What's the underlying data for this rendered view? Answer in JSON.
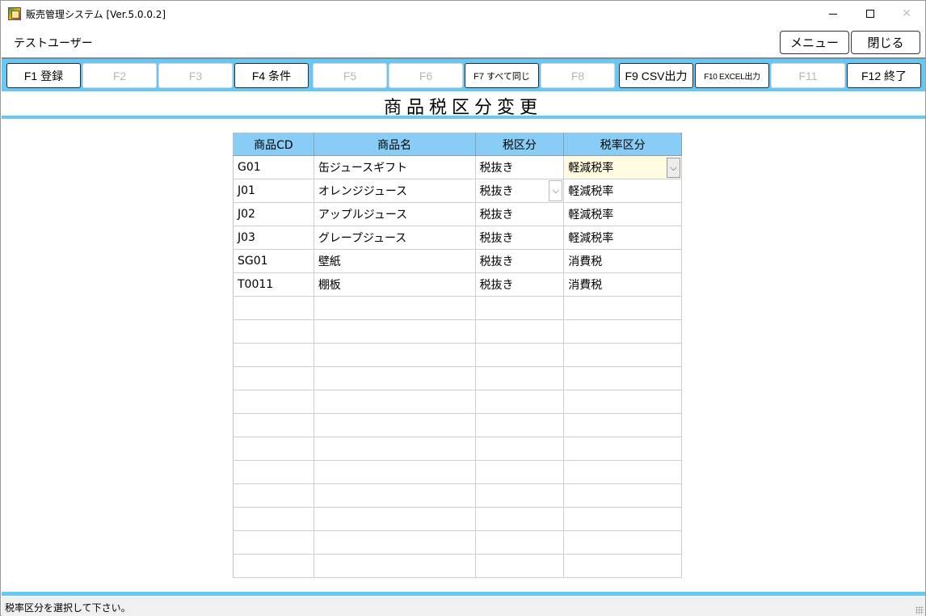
{
  "window": {
    "title": "販売管理システム [Ver.5.0.0.2]",
    "minimize_icon": "minimize-icon",
    "maximize_icon": "maximize-icon",
    "close_icon": "close-icon",
    "close_glyph": "✕"
  },
  "header": {
    "user": "テストユーザー",
    "menu_label": "メニュー",
    "close_label": "閉じる"
  },
  "fkeys": [
    {
      "label": "F1 登録",
      "enabled": true
    },
    {
      "label": "F2",
      "enabled": false
    },
    {
      "label": "F3",
      "enabled": false
    },
    {
      "label": "F4 条件",
      "enabled": true
    },
    {
      "label": "F5",
      "enabled": false
    },
    {
      "label": "F6",
      "enabled": false
    },
    {
      "label": "F7 すべて同じ",
      "enabled": true
    },
    {
      "label": "F8",
      "enabled": false
    },
    {
      "label": "F9 CSV出力",
      "enabled": true
    },
    {
      "label": "F10 EXCEL出力",
      "enabled": true
    },
    {
      "label": "F11",
      "enabled": false
    },
    {
      "label": "F12 終了",
      "enabled": true
    }
  ],
  "page": {
    "title": "商品税区分変更"
  },
  "grid": {
    "columns": [
      "商品CD",
      "商品名",
      "税区分",
      "税率区分"
    ],
    "rows": [
      [
        "G01",
        "缶ジュースギフト",
        "税抜き",
        "軽減税率"
      ],
      [
        "J01",
        "オレンジジュース",
        "税抜き",
        "軽減税率"
      ],
      [
        "J02",
        "アップルジュース",
        "税抜き",
        "軽減税率"
      ],
      [
        "J03",
        "グレープジュース",
        "税抜き",
        "軽減税率"
      ],
      [
        "SG01",
        "壁紙",
        "税抜き",
        "消費税"
      ],
      [
        "T0011",
        "棚板",
        "税抜き",
        "消費税"
      ],
      [
        "",
        "",
        "",
        ""
      ],
      [
        "",
        "",
        "",
        ""
      ],
      [
        "",
        "",
        "",
        ""
      ],
      [
        "",
        "",
        "",
        ""
      ],
      [
        "",
        "",
        "",
        ""
      ],
      [
        "",
        "",
        "",
        ""
      ],
      [
        "",
        "",
        "",
        ""
      ],
      [
        "",
        "",
        "",
        ""
      ],
      [
        "",
        "",
        "",
        ""
      ],
      [
        "",
        "",
        "",
        ""
      ],
      [
        "",
        "",
        "",
        ""
      ],
      [
        "",
        "",
        "",
        ""
      ]
    ],
    "dropdown_glyph": "⌵"
  },
  "status": {
    "message": "税率区分を選択して下さい。"
  },
  "colors": {
    "accent": "#66c8f4",
    "header_bg": "#87cdf5",
    "active_cell": "#fffbe0"
  }
}
